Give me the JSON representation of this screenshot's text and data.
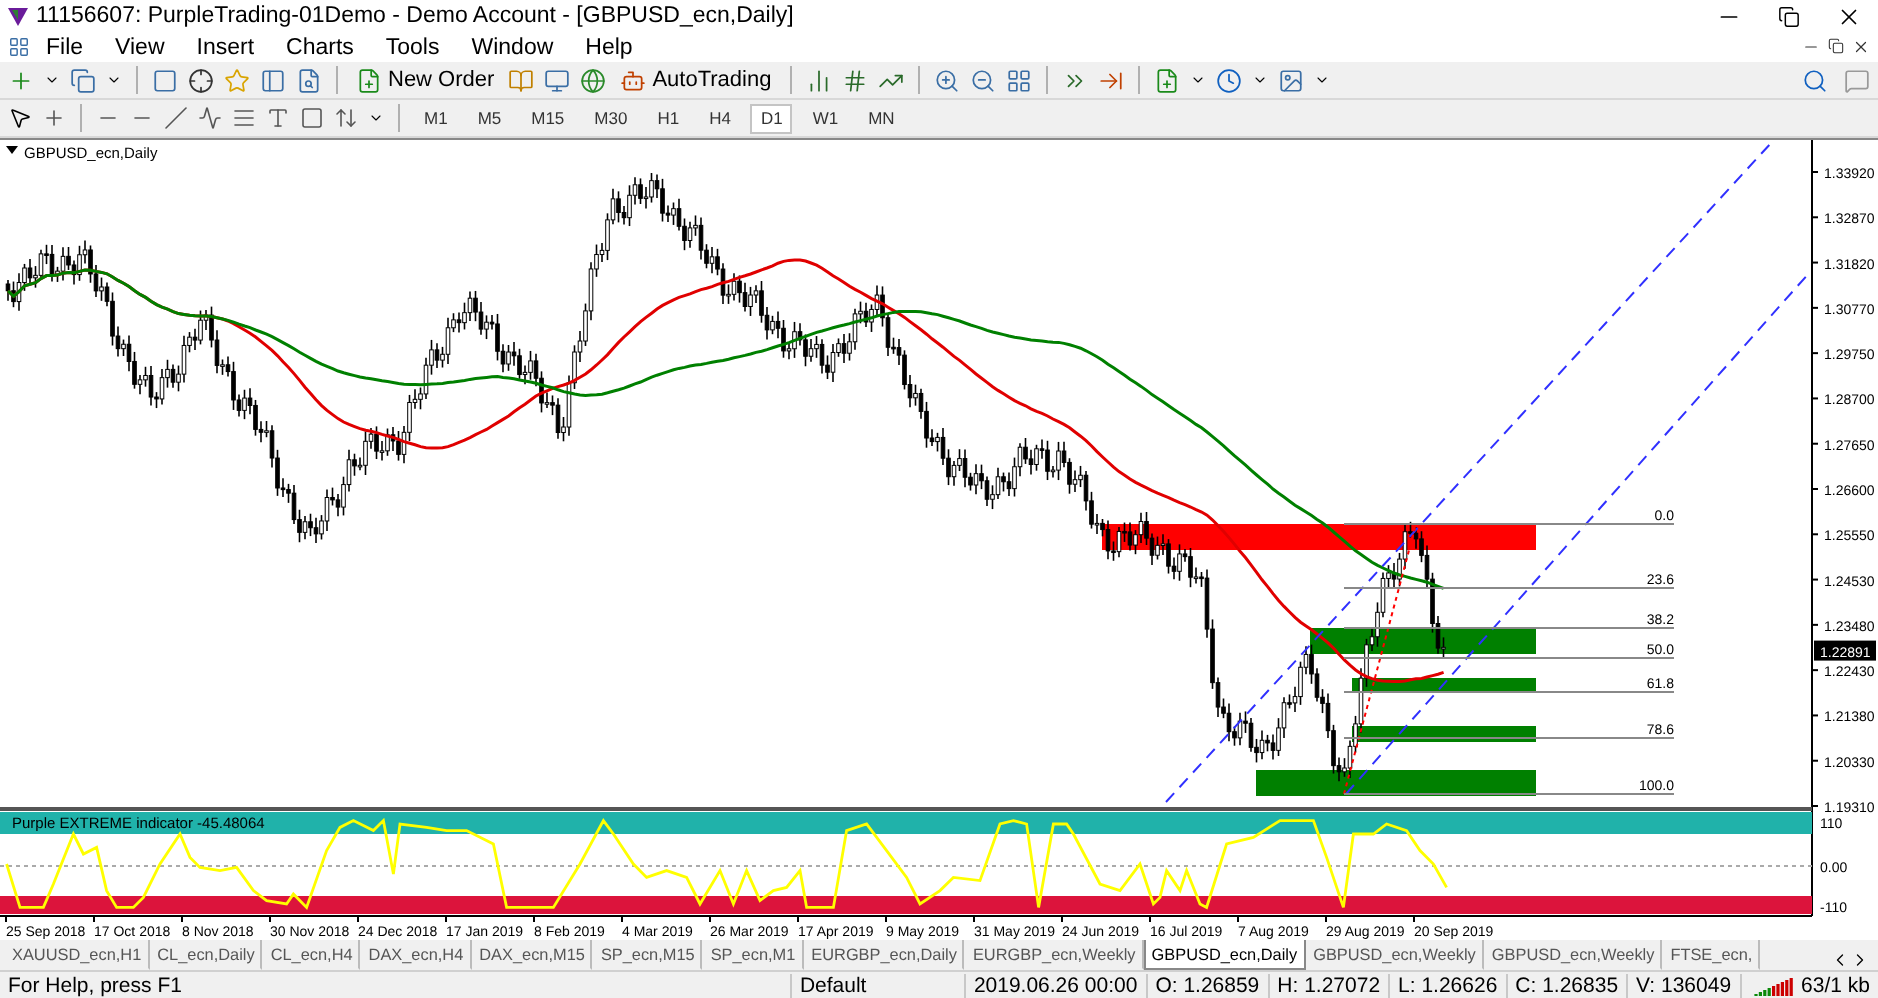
{
  "window": {
    "title": "11156607: PurpleTrading-01Demo - Demo Account - [GBPUSD_ecn,Daily]"
  },
  "menu": [
    "File",
    "View",
    "Insert",
    "Charts",
    "Tools",
    "Window",
    "Help"
  ],
  "toolbar": {
    "new_order": "New Order",
    "autotrading": "AutoTrading"
  },
  "timeframes": [
    {
      "label": "M1",
      "selected": false
    },
    {
      "label": "M5",
      "selected": false
    },
    {
      "label": "M15",
      "selected": false
    },
    {
      "label": "M30",
      "selected": false
    },
    {
      "label": "H1",
      "selected": false
    },
    {
      "label": "H4",
      "selected": false
    },
    {
      "label": "D1",
      "selected": true
    },
    {
      "label": "W1",
      "selected": false
    },
    {
      "label": "MN",
      "selected": false
    }
  ],
  "chart": {
    "symbol": "GBPUSD_ecn,Daily",
    "price_axis": [
      "1.33920",
      "1.32870",
      "1.31820",
      "1.30770",
      "1.29750",
      "1.28700",
      "1.27650",
      "1.26600",
      "1.25550",
      "1.24530",
      "1.23480",
      "1.22430",
      "1.21380",
      "1.20330",
      "1.19310"
    ],
    "current_price": "1.22891",
    "fib_levels": [
      "0.0",
      "23.6",
      "38.2",
      "50.0",
      "61.8",
      "78.6",
      "100.0"
    ],
    "indicator": {
      "label": "Purple EXTREME indicator -45.48064",
      "axis": [
        "110",
        "0.00",
        "-110"
      ]
    },
    "date_axis": [
      "25 Sep 2018",
      "17 Oct 2018",
      "8 Nov 2018",
      "30 Nov 2018",
      "24 Dec 2018",
      "17 Jan 2019",
      "8 Feb 2019",
      "4 Mar 2019",
      "26 Mar 2019",
      "17 Apr 2019",
      "9 May 2019",
      "31 May 2019",
      "24 Jun 2019",
      "16 Jul 2019",
      "7 Aug 2019",
      "29 Aug 2019",
      "20 Sep 2019"
    ]
  },
  "tabs": [
    {
      "label": "XAUUSD_ecn,H1",
      "selected": false
    },
    {
      "label": "CL_ecn,Daily",
      "selected": false
    },
    {
      "label": "CL_ecn,H4",
      "selected": false
    },
    {
      "label": "DAX_ecn,H4",
      "selected": false
    },
    {
      "label": "DAX_ecn,M15",
      "selected": false
    },
    {
      "label": "SP_ecn,M15",
      "selected": false
    },
    {
      "label": "SP_ecn,M1",
      "selected": false
    },
    {
      "label": "EURGBP_ecn,Daily",
      "selected": false
    },
    {
      "label": "EURGBP_ecn,Weekly",
      "selected": false
    },
    {
      "label": "GBPUSD_ecn,Daily",
      "selected": true
    },
    {
      "label": "GBPUSD_ecn,Weekly",
      "selected": false
    },
    {
      "label": "GBPUSD_ecn,Weekly",
      "selected": false
    },
    {
      "label": "FTSE_ecn,",
      "selected": false
    }
  ],
  "status_bar": {
    "help": "For Help, press F1",
    "profile": "Default",
    "time": "2019.06.26 00:00",
    "open": "O: 1.26859",
    "high": "H: 1.27072",
    "low": "L: 1.26626",
    "close": "C: 1.26835",
    "volume": "V: 136049",
    "traffic": "63/1 kb"
  }
}
